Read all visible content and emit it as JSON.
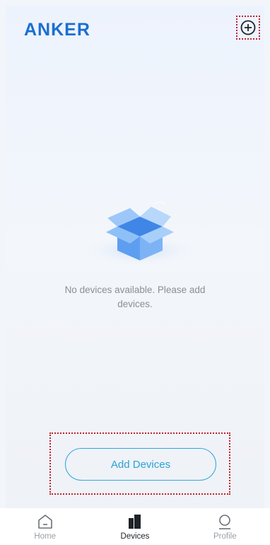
{
  "header": {
    "logo_text": "ANKER"
  },
  "icons": {
    "add": "plus-circle-icon",
    "empty_state": "open-box-illustration"
  },
  "empty_state": {
    "message": "No devices available. Please add devices."
  },
  "actions": {
    "add_devices_label": "Add Devices"
  },
  "tabbar": {
    "tabs": [
      {
        "label": "Home",
        "icon": "home-icon",
        "active": false
      },
      {
        "label": "Devices",
        "icon": "devices-icon",
        "active": true
      },
      {
        "label": "Profile",
        "icon": "profile-icon",
        "active": false
      }
    ]
  },
  "colors": {
    "brand": "#1a6fcf",
    "accent": "#2aa2d8",
    "highlight_outline": "#c0212b"
  }
}
